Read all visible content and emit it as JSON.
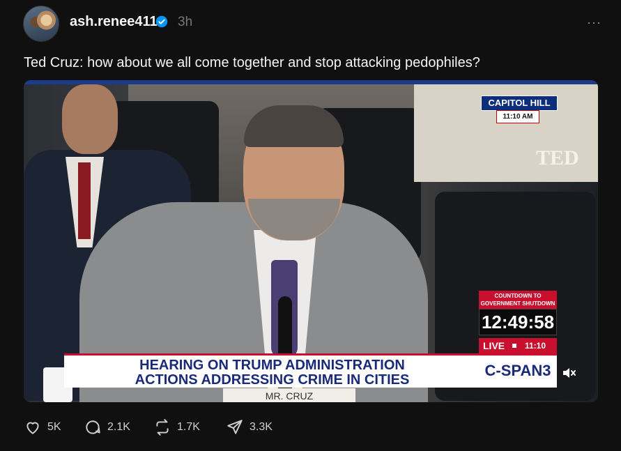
{
  "post": {
    "username": "ash.renee411",
    "timestamp": "3h",
    "text": "Ted Cruz: how about we all come together and stop attacking pedophiles?",
    "more_label": "···"
  },
  "video": {
    "capitol_tag": "CAPITOL HILL",
    "capitol_time": "11:10 AM",
    "placard_text": "TED",
    "countdown_label": "COUNTDOWN TO GOVERNMENT SHUTDOWN",
    "countdown_clock": "12:49:58",
    "live_label": "LIVE",
    "live_time": "11:10 ET",
    "chyron_line1": "HEARING ON TRUMP ADMINISTRATION",
    "chyron_line2": "ACTIONS ADDRESSING CRIME IN CITIES",
    "network": "C-SPAN3",
    "nameplate": "MR. CRUZ",
    "muted": true
  },
  "actions": {
    "likes": "5K",
    "replies": "2.1K",
    "reposts": "1.7K",
    "shares": "3.3K"
  },
  "colors": {
    "background": "#101010",
    "verified": "#0095f6",
    "chyron_text": "#1a2a7a",
    "cspan_red": "#c8102e"
  }
}
